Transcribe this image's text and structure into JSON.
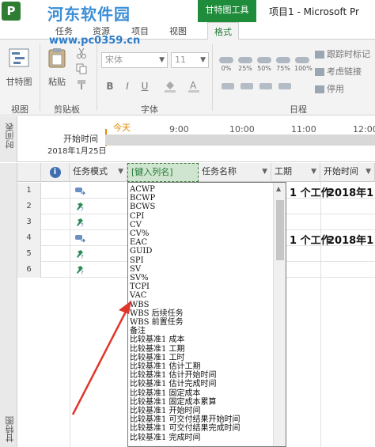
{
  "window": {
    "title": "项目1 - Microsoft Pr",
    "context_tab": "甘特图工具",
    "watermark": "河东软件园",
    "watermark_url": "www.pc0359.cn"
  },
  "ribbon_tabs": [
    {
      "label": "任务"
    },
    {
      "label": "资源"
    },
    {
      "label": "项目"
    },
    {
      "label": "视图"
    },
    {
      "label": "格式"
    }
  ],
  "ribbon": {
    "groups": {
      "view": "视图",
      "clipboard": "剪贴板",
      "font": "字体",
      "schedule": "日程"
    },
    "gantt_button": "甘特图",
    "paste_button": "粘贴",
    "font_name": "宋体",
    "font_size": "11",
    "bold": "B",
    "italic": "I",
    "underline": "U",
    "percent_buttons": [
      "0%",
      "25%",
      "50%",
      "75%",
      "100%"
    ],
    "schedule_items": [
      "跟踪时标记",
      "考虑链接",
      "停用"
    ]
  },
  "timeline": {
    "side_label": "时间表",
    "today": "今天",
    "start_label": "开始时间",
    "start_date": "2018年1月25日",
    "ticks": [
      "9:00",
      "10:00",
      "11:00",
      "12:00"
    ]
  },
  "grid": {
    "side_label": "甘特图",
    "columns": {
      "info": "i",
      "task_mode": "任务模式",
      "insert_column": "[键入列名]",
      "task_name": "任务名称",
      "duration": "工期",
      "start": "开始时间"
    },
    "rows": [
      {
        "num": "1",
        "duration": "1 个工作",
        "start": "2018年1"
      },
      {
        "num": "2",
        "duration": "",
        "start": ""
      },
      {
        "num": "3",
        "duration": "",
        "start": ""
      },
      {
        "num": "4",
        "duration": "1 个工作",
        "start": "2018年1"
      },
      {
        "num": "5",
        "duration": "",
        "start": ""
      },
      {
        "num": "6",
        "duration": "",
        "start": ""
      }
    ]
  },
  "column_dropdown": {
    "items": [
      "ACWP",
      "BCWP",
      "BCWS",
      "CPI",
      "CV",
      "CV%",
      "EAC",
      "GUID",
      "SPI",
      "SV",
      "SV%",
      "TCPI",
      "VAC",
      "WBS",
      "WBS 后续任务",
      "WBS 前置任务",
      "备注",
      "比较基准1 成本",
      "比较基准1 工期",
      "比较基准1 工时",
      "比较基准1 估计工期",
      "比较基准1 估计开始时间",
      "比较基准1 估计完成时间",
      "比较基准1 固定成本",
      "比较基准1 固定成本累算",
      "比较基准1 开始时间",
      "比较基准1 可交付结果开始时间",
      "比较基准1 可交付结果完成时间",
      "比较基准1 完成时间"
    ]
  },
  "colors": {
    "accent_green": "#1e8c3a",
    "arrow_red": "#e0352b",
    "today_orange": "#e08a00"
  }
}
